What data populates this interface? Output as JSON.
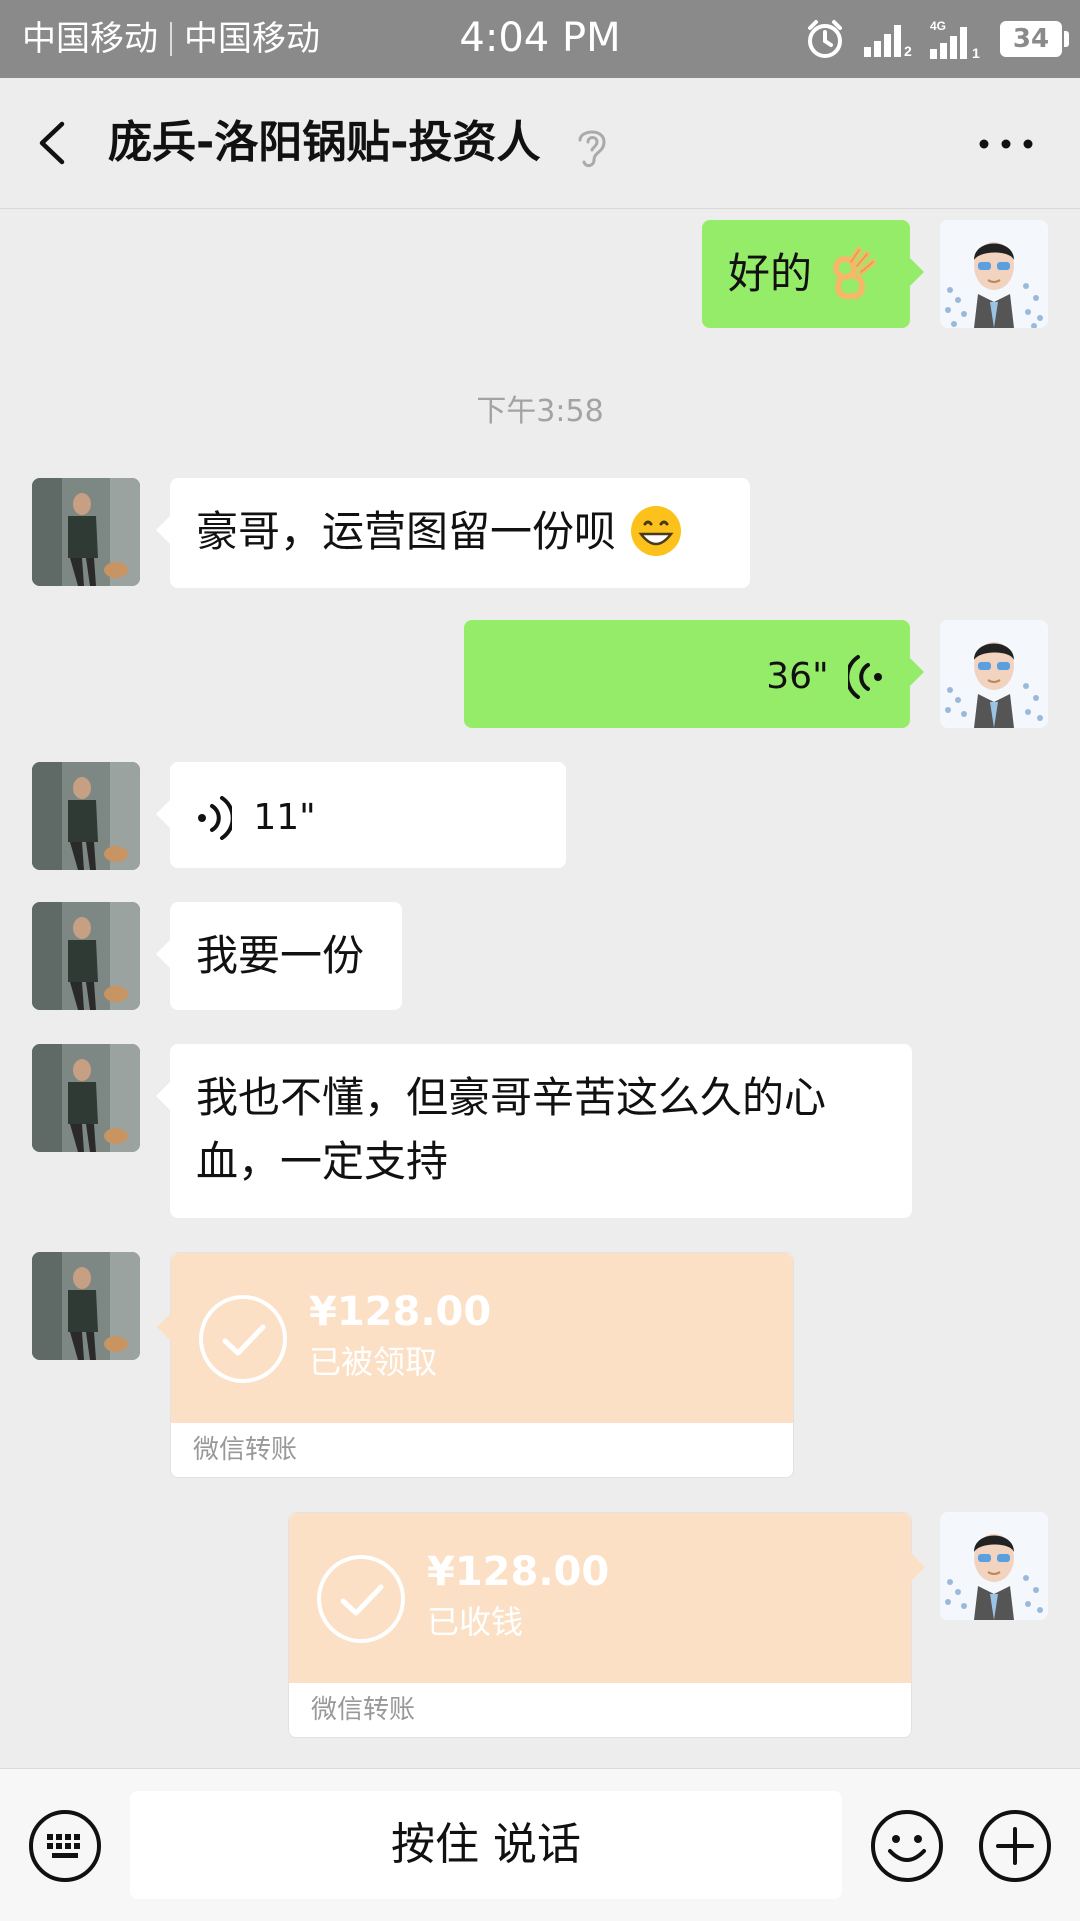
{
  "status_bar": {
    "carrier1": "中国移动",
    "carrier2": "中国移动",
    "time": "4:04 PM",
    "battery": "34",
    "network": "4G"
  },
  "chat": {
    "title": "庞兵-洛阳锅贴-投资人"
  },
  "messages": {
    "m1": {
      "text": "好的"
    },
    "timestamp": "下午3:58",
    "m2": {
      "text": "豪哥，运营图留一份呗"
    },
    "m3": {
      "duration": "36\""
    },
    "m4": {
      "duration": "11\""
    },
    "m5": {
      "text": "我要一份"
    },
    "m6": {
      "line1": "我也不懂，但豪哥辛苦这么久的心",
      "line2": "血，一定支持"
    },
    "t1": {
      "amount": "¥128.00",
      "status": "已被领取",
      "label": "微信转账"
    },
    "t2": {
      "amount": "¥128.00",
      "status": "已收钱",
      "label": "微信转账"
    }
  },
  "input_bar": {
    "hold_to_talk": "按住 说话"
  },
  "colors": {
    "outgoing_bubble": "#95ec69",
    "incoming_bubble": "#ffffff",
    "transfer_card": "#fbe0c5",
    "background": "#ededed"
  }
}
